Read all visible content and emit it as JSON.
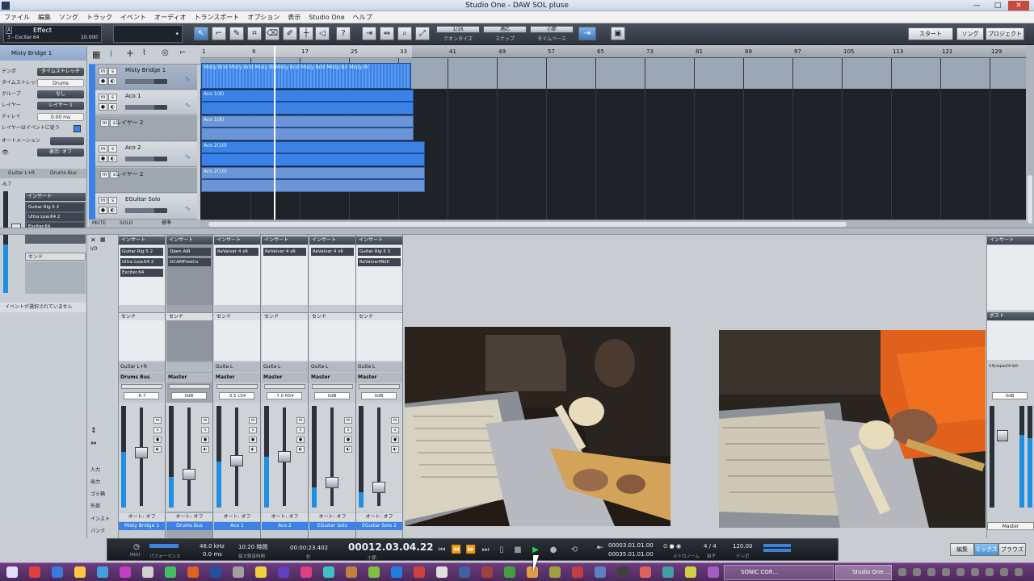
{
  "window": {
    "title": "Studio One - DAW SOL pluse",
    "min": "—",
    "max": "□",
    "close": "✕"
  },
  "menu": [
    "ファイル",
    "編集",
    "ソング",
    "トラック",
    "イベント",
    "オーディオ",
    "トランスポート",
    "オプション",
    "表示",
    "Studio One",
    "ヘルプ"
  ],
  "toolbar": {
    "effect_label": "Effect",
    "effect_sub": "3 - Exciter.64",
    "effect_val": "10.000",
    "quantize_value": "1/16",
    "quantize_caption": "クオンタイズ",
    "snap_value": "適応",
    "snap_caption": "スナップ",
    "timebase_value": "小節",
    "timebase_caption": "タイムベース",
    "start_label": "スタート",
    "song_label": "ソング",
    "project_label": "プロジェクト"
  },
  "inspector": {
    "track_name": "Misty Bridge 1",
    "rows": [
      {
        "label": "テンポ",
        "value": "タイムストレッチ"
      },
      {
        "label": "タイムストレッチ",
        "value": "Drums"
      },
      {
        "label": "グループ",
        "value": "なし"
      },
      {
        "label": "レイヤー",
        "value": "レイヤー 1"
      },
      {
        "label": "ディレイ",
        "value": "0.00 ms"
      },
      {
        "label": "レイヤーはイベントに従う",
        "value": ""
      },
      {
        "label": "オートメーション",
        "value": ""
      },
      {
        "label": "",
        "value": "表示: オフ"
      }
    ],
    "channel_a": "Guitar L+R",
    "channel_b": "Drums Bus",
    "vol": "-6.7",
    "insert_header": "インサート",
    "inserts": [
      "Guitar Rig 5 2",
      "Ultra Low.64 2",
      "Exciter.64"
    ],
    "send_header": "センド",
    "status": "イベントが選択されていません"
  },
  "ruler": [
    "1",
    "9",
    "17",
    "25",
    "33",
    "41",
    "49",
    "57",
    "65",
    "73",
    "81",
    "89",
    "97",
    "105",
    "113",
    "121",
    "129"
  ],
  "tracks": [
    {
      "name": "Misty Bridge 1",
      "clip": "Misty Brid  Misty Brid  Misty Bi  Misty Brid  Misty Brid  Misty Bri  Misty Br"
    },
    {
      "name": "Aco 1",
      "clip": "Aco 1(8)"
    },
    {
      "name": "レイヤー 2",
      "clip": "Aco 1(8)"
    },
    {
      "name": "Aco 2",
      "clip": "Aco 2(10)"
    },
    {
      "name": "レイヤー 2",
      "clip": "Aco 2(10)"
    },
    {
      "name": "EGuitar Solo",
      "clip": ""
    }
  ],
  "tracklist_footer": {
    "mute": "MUTE",
    "solo": "SOLO",
    "std": "標準"
  },
  "mixer_left": {
    "io": "I/O",
    "labels": [
      "入力",
      "出力",
      "ゴミ箱",
      "外部",
      "インスト",
      "パンク"
    ]
  },
  "strips": [
    {
      "insert": "インサート",
      "slots": [
        "Guitar Rig 5 2",
        "Ultra Low.64 2",
        "Exciter.64"
      ],
      "send": "センド",
      "in": "Guitar L+R",
      "out": "Drums Bus",
      "pan": "-6.7",
      "auto": "オート: オフ",
      "name": "Misty Bridge 1",
      "level": 0.55
    },
    {
      "insert": "インサート",
      "slots": [
        "Open AIR",
        "DCAMFreeCo"
      ],
      "send": "センド",
      "in": "",
      "out": "Master",
      "pan": "0dB",
      "auto": "オート: オフ",
      "name": "Drums Bus",
      "level": 0.3
    },
    {
      "insert": "インサート",
      "slots": [
        "ReValver 4 x6"
      ],
      "send": "センド",
      "in": "Guita L",
      "out": "Master",
      "pan": "-3.5   L54",
      "auto": "オート: オフ",
      "name": "Aco 1",
      "level": 0.45
    },
    {
      "insert": "インサート",
      "slots": [
        "ReValver 4 x6"
      ],
      "send": "センド",
      "in": "Guita L",
      "out": "Master",
      "pan": "-7.0   R54",
      "auto": "オート: オフ",
      "name": "Aco 2",
      "level": 0.5
    },
    {
      "insert": "インサート",
      "slots": [
        "ReValver 4 x6"
      ],
      "send": "センド",
      "in": "Guita L",
      "out": "Master",
      "pan": "0dB",
      "auto": "オート: オフ",
      "name": "EGuitar Solo",
      "level": 0.2
    },
    {
      "insert": "インサート",
      "slots": [
        "Guitar Rig 5 3",
        "ReValverMkIII"
      ],
      "send": "センド",
      "in": "Guita L",
      "out": "Master",
      "pan": "0dB",
      "auto": "オート: オフ",
      "name": "EGuitar Solo 2",
      "level": 0.15
    }
  ],
  "mixer_right": {
    "insert": "インサート",
    "post": "ポスト",
    "plugin": "1Scope24-bit",
    "vol": "0dB",
    "name": "Master"
  },
  "transport": {
    "midi": "MIDI",
    "perf": "パフォーマンス",
    "rate": "48.0 kHz",
    "latency": "0.0 ms",
    "rec_time": "10:20 時間",
    "rec_cap": "最大録音時間",
    "seconds": "00:00:23.402",
    "sec_cap": "秒",
    "bars": "00012.03.04.22",
    "bars_cap": "小節",
    "loop_start": "00003.01.01.00",
    "loop_end": "00035.01.01.00",
    "metronome": "メトロノーム",
    "sig": "4 / 4",
    "sig_cap": "拍子",
    "tempo": "120.00",
    "tempo_cap": "テンポ"
  },
  "view_tabs": [
    "編集",
    "ミックス",
    "ブラウズ"
  ],
  "taskbar": {
    "win1": "SONIC COR...",
    "win2": "Studio One ..."
  }
}
